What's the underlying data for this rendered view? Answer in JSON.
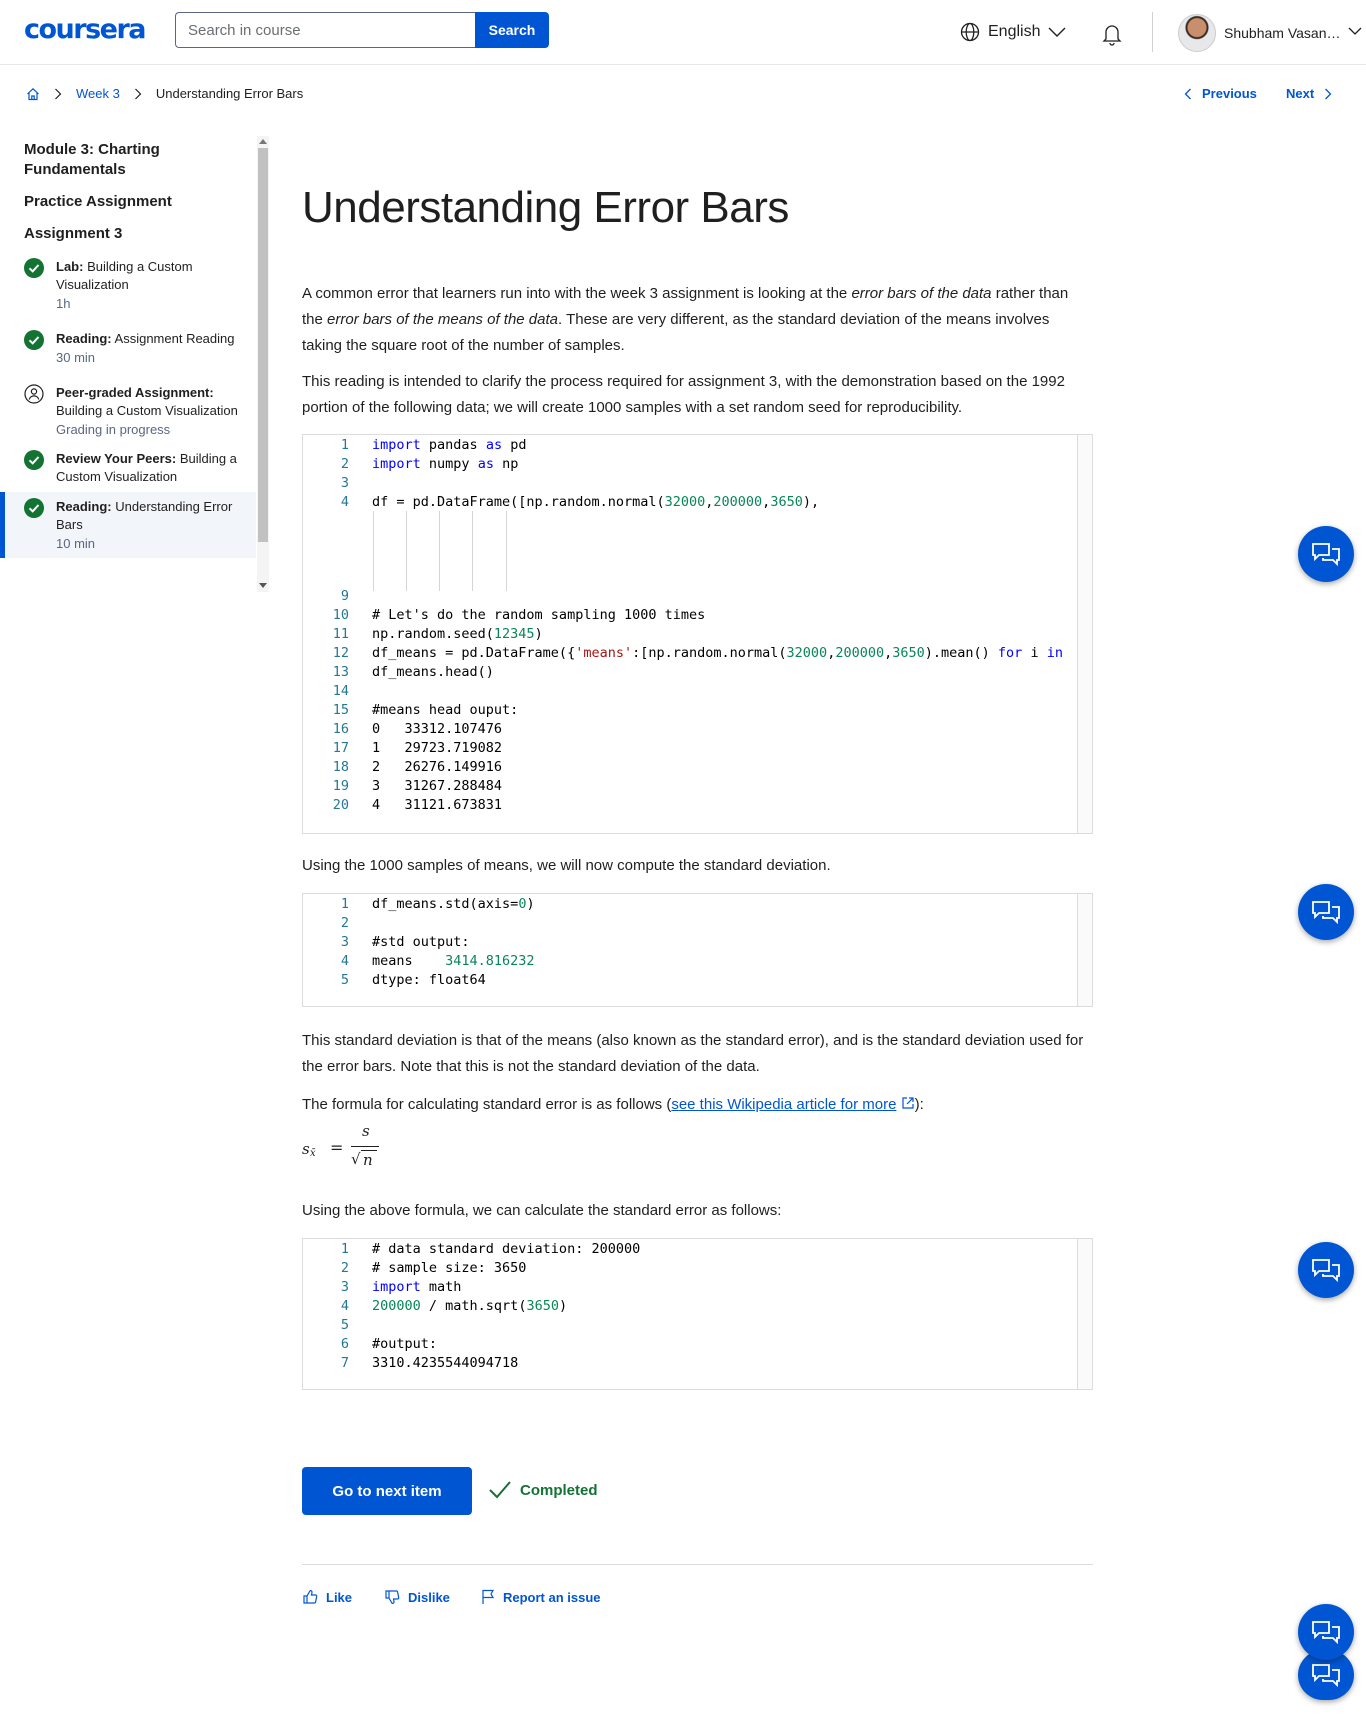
{
  "header": {
    "logo": "coursera",
    "search_placeholder": "Search in course",
    "search_label": "Search",
    "language": "English",
    "user_name": "Shubham Vasant ..."
  },
  "breadcrumb": {
    "week": "Week 3",
    "current": "Understanding Error Bars",
    "previous": "Previous",
    "next": "Next"
  },
  "sidebar": {
    "module_title": "Module 3: Charting Fundamentals",
    "practice": "Practice Assignment",
    "assignment": "Assignment 3",
    "items": [
      {
        "type": "Lab:",
        "title": "Building a Custom Visualization",
        "meta": "1h",
        "status": "done"
      },
      {
        "type": "Reading:",
        "title": "Assignment Reading",
        "meta": "30 min",
        "status": "done"
      },
      {
        "type": "Peer-graded Assignment:",
        "title": "Building a Custom Visualization",
        "meta": "Grading in progress",
        "status": "peer"
      },
      {
        "type": "Review Your Peers:",
        "title": "Building a Custom Visualization",
        "meta": "",
        "status": "done"
      },
      {
        "type": "Reading:",
        "title": "Understanding Error Bars",
        "meta": "10 min",
        "status": "done"
      }
    ]
  },
  "content": {
    "title": "Understanding Error Bars",
    "p1_a": "A common error that learners run into with the week 3 assignment is looking at the ",
    "p1_i1": "error bars of the data",
    "p1_b": " rather than the ",
    "p1_i2": "error bars of the means of the data",
    "p1_c": ". These are very different, as the standard deviation of the means involves taking the square root of the number of samples.",
    "p2": "This reading is intended to clarify the process required for assignment 3, with the demonstration based on the 1992 portion of the following data; we will create 1000 samples with a set random seed for reproducibility.",
    "p3": "Using the 1000 samples of means, we will now compute the standard deviation.",
    "p4": "This standard deviation is that of the means (also known as the standard error), and is the standard deviation used for the error bars. Note that this is not the standard deviation of the data.",
    "p5_a": "The formula for calculating standard error is as follows (",
    "p5_link": "see this Wikipedia article for more",
    "p5_b": "):",
    "p6": "Using the above formula, we can calculate the standard error as follows:",
    "formula": {
      "lhs": "s",
      "sub": "x̄",
      "eq": "=",
      "num": "s",
      "den": "n"
    }
  },
  "code1": {
    "line_numbers": [
      "1",
      "2",
      "3",
      "4",
      "9",
      "10",
      "11",
      "12",
      "13",
      "14",
      "15",
      "16",
      "17",
      "18",
      "19",
      "20"
    ],
    "l1_kw": "import",
    "l1_rest": " pandas ",
    "l1_as": "as",
    "l1_alias": " pd",
    "l2_kw": "import",
    "l2_rest": " numpy ",
    "l2_as": "as",
    "l2_alias": " np",
    "l4_a": "df = pd.DataFrame([np.random.normal(",
    "l4_n1": "32000",
    "l4_n2": "200000",
    "l4_n3": "3650",
    "l4_b": "),",
    "l10": "# Let's do the random sampling 1000 times",
    "l11_a": "np.random.seed(",
    "l11_n": "12345",
    "l11_b": ")",
    "l12_a": "df_means = pd.DataFrame({",
    "l12_s": "'means'",
    "l12_b": ":[np.random.normal(",
    "l12_n1": "32000",
    "l12_n2": "200000",
    "l12_n3": "3650",
    "l12_c": ").mean() ",
    "l12_for": "for",
    "l12_d": " i ",
    "l12_in": "in",
    "l13": "df_means.head()",
    "l15": "#means head ouput:",
    "out_idx": [
      "0",
      "1",
      "2",
      "3",
      "4"
    ],
    "out_vals": [
      "33312.107476",
      "29723.719082",
      "26276.149916",
      "31267.288484",
      "31121.673831"
    ]
  },
  "code2": {
    "line_numbers": [
      "1",
      "2",
      "3",
      "4",
      "5"
    ],
    "l1_a": "df_means.std(axis=",
    "l1_n": "0",
    "l1_b": ")",
    "l3": "#std output:",
    "l4_a": "means    ",
    "l4_n": "3414.816232",
    "l5": "dtype: float64"
  },
  "code3": {
    "line_numbers": [
      "1",
      "2",
      "3",
      "4",
      "5",
      "6",
      "7"
    ],
    "l1": "# data standard deviation: 200000",
    "l2": "# sample size: 3650",
    "l3_kw": "import",
    "l3_rest": " math",
    "l4_n1": "200000",
    "l4_a": " / math.sqrt(",
    "l4_n2": "3650",
    "l4_b": ")",
    "l6": "#output:",
    "l7": "3310.4235544094718"
  },
  "footer": {
    "next_item": "Go to next item",
    "completed": "Completed",
    "like": "Like",
    "dislike": "Dislike",
    "report": "Report an issue"
  },
  "colors": {
    "brand": "#0056d2",
    "success": "#137333"
  }
}
